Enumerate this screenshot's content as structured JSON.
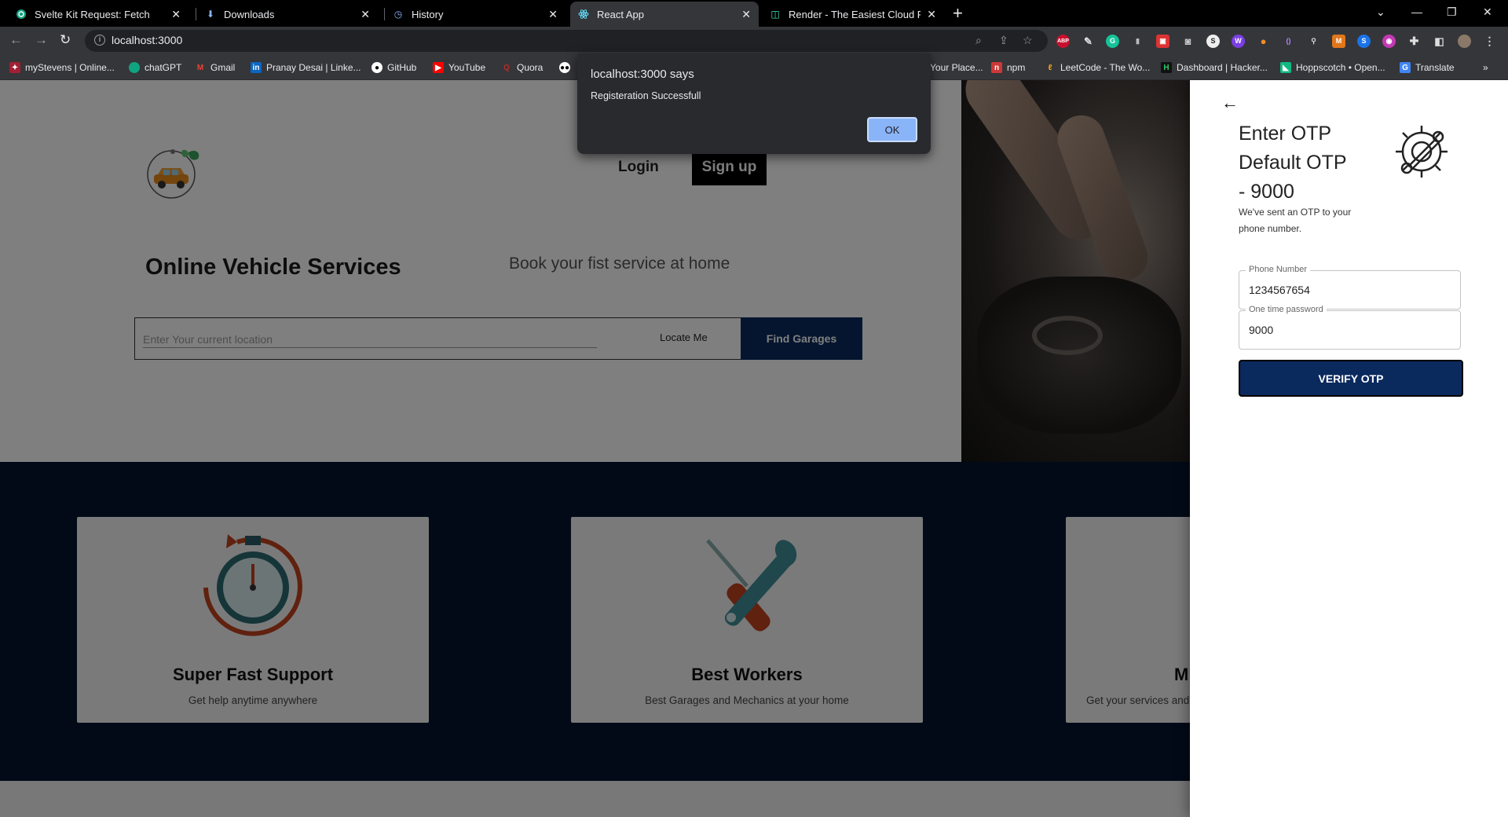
{
  "browser": {
    "tabs": [
      {
        "title": "Svelte Kit Request: Fetch",
        "icon": "chatgpt-icon"
      },
      {
        "title": "Downloads",
        "icon": "download-icon"
      },
      {
        "title": "History",
        "icon": "history-icon"
      },
      {
        "title": "React App",
        "icon": "react-icon",
        "active": true
      },
      {
        "title": "Render - The Easiest Cloud For All",
        "icon": "render-icon"
      }
    ],
    "url": "localhost:3000",
    "bookmarks": [
      "myStevens | Online...",
      "chatGPT",
      "Gmail",
      "Pranay Desai | Linke...",
      "GitHub",
      "YouTube",
      "Quora",
      "Your Place...",
      "npm",
      "LeetCode - The Wo...",
      "Dashboard | Hacker...",
      "Hoppscotch • Open...",
      "Translate"
    ]
  },
  "alert": {
    "title": "localhost:3000 says",
    "message": "Registeration Successfull",
    "ok_label": "OK"
  },
  "page": {
    "nav": {
      "login": "Login",
      "signup": "Sign up"
    },
    "hero": {
      "title": "Online Vehicle Services",
      "subtitle": "Book your fist service at home"
    },
    "search": {
      "placeholder": "Enter Your current location",
      "locate_label": "Locate Me",
      "find_label": "Find Garages"
    },
    "features": [
      {
        "title": "Super Fast Support",
        "desc": "Get help anytime anywhere",
        "icon": "stopwatch-icon"
      },
      {
        "title": "Best Workers",
        "desc": "Best Garages and Mechanics at your home",
        "icon": "tools-icon"
      },
      {
        "title": "M",
        "desc": "Get your services and",
        "icon": ""
      }
    ]
  },
  "otp_drawer": {
    "title_line1": "Enter OTP",
    "title_line2": "Default OTP",
    "title_line3": "- 9000",
    "message": "We've sent an OTP to your phone number.",
    "phone_label": "Phone Number",
    "phone_value": "1234567654",
    "otp_label": "One time password",
    "otp_value": "9000",
    "verify_label": "VERIFY OTP"
  }
}
